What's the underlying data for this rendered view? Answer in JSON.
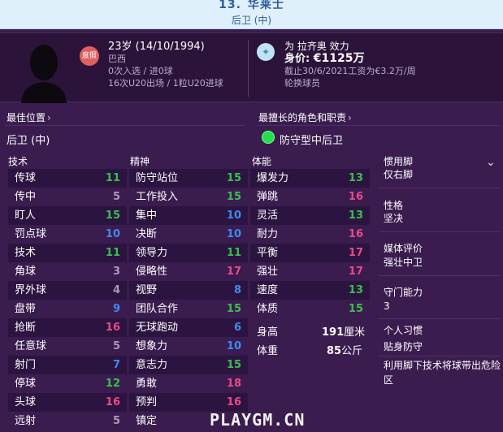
{
  "header": {
    "number": "13.",
    "name": "华莱士",
    "position": "后卫 (中)"
  },
  "profile": {
    "badge_text": "度假",
    "age_dob": "23岁 (14/10/1994)",
    "nation": "巴西",
    "caps": "0次入选 / 进0球",
    "u20": "16次U20出场 / 1粒U20进球",
    "club_line": "为 拉齐奥 效力",
    "value_label": "身价: ",
    "value": "€1125万",
    "contract": "截止30/6/2021工资为€3.2万/周",
    "status": "轮换球员"
  },
  "best_position": {
    "label": "最佳位置",
    "value": "后卫 (中)"
  },
  "best_role": {
    "label": "最擅长的角色和职责",
    "value": "防守型中后卫"
  },
  "columns": {
    "technical": "技术",
    "mental": "精神",
    "physical": "体能"
  },
  "technical": [
    {
      "name": "传球",
      "value": "11"
    },
    {
      "name": "传中",
      "value": "5"
    },
    {
      "name": "盯人",
      "value": "15"
    },
    {
      "name": "罚点球",
      "value": "10"
    },
    {
      "name": "技术",
      "value": "11"
    },
    {
      "name": "角球",
      "value": "3"
    },
    {
      "name": "界外球",
      "value": "4"
    },
    {
      "name": "盘带",
      "value": "9"
    },
    {
      "name": "抢断",
      "value": "16"
    },
    {
      "name": "任意球",
      "value": "5"
    },
    {
      "name": "射门",
      "value": "7"
    },
    {
      "name": "停球",
      "value": "12"
    },
    {
      "name": "头球",
      "value": "16"
    },
    {
      "name": "远射",
      "value": "5"
    }
  ],
  "mental": [
    {
      "name": "防守站位",
      "value": "15"
    },
    {
      "name": "工作投入",
      "value": "15"
    },
    {
      "name": "集中",
      "value": "10"
    },
    {
      "name": "决断",
      "value": "10"
    },
    {
      "name": "领导力",
      "value": "11"
    },
    {
      "name": "侵略性",
      "value": "17"
    },
    {
      "name": "视野",
      "value": "8"
    },
    {
      "name": "团队合作",
      "value": "15"
    },
    {
      "name": "无球跑动",
      "value": "6"
    },
    {
      "name": "想象力",
      "value": "10"
    },
    {
      "name": "意志力",
      "value": "15"
    },
    {
      "name": "勇敢",
      "value": "18"
    },
    {
      "name": "预判",
      "value": "16"
    },
    {
      "name": "镇定",
      "value": ""
    }
  ],
  "physical": [
    {
      "name": "爆发力",
      "value": "13"
    },
    {
      "name": "弹跳",
      "value": "16"
    },
    {
      "name": "灵活",
      "value": "13"
    },
    {
      "name": "耐力",
      "value": "16"
    },
    {
      "name": "平衡",
      "value": "17"
    },
    {
      "name": "强壮",
      "value": "17"
    },
    {
      "name": "速度",
      "value": "13"
    },
    {
      "name": "体质",
      "value": "15"
    }
  ],
  "body": {
    "height_label": "身高",
    "height_value": "191",
    "height_unit": "厘米",
    "weight_label": "体重",
    "weight_value": "85",
    "weight_unit": "公斤"
  },
  "right_panel": {
    "foot_label": "惯用脚",
    "foot_value": "仅右脚",
    "personality_label": "性格",
    "personality_value": "坚决",
    "media_label": "媒体评价",
    "media_value": "强壮中卫",
    "gk_label": "守门能力",
    "gk_value": "3",
    "habits_label": "个人习惯",
    "habit_1": "贴身防守",
    "habit_2": "利用脚下技术将球带出危险区"
  },
  "watermark": "PLAYGM.CN",
  "colors": {
    "green": "#35c24a",
    "blue": "#3c8cf0",
    "grey": "#a99bb6",
    "pink": "#ea4a86",
    "header_bg": "#dff0fb",
    "panel_bg": "#3a1c4f"
  }
}
